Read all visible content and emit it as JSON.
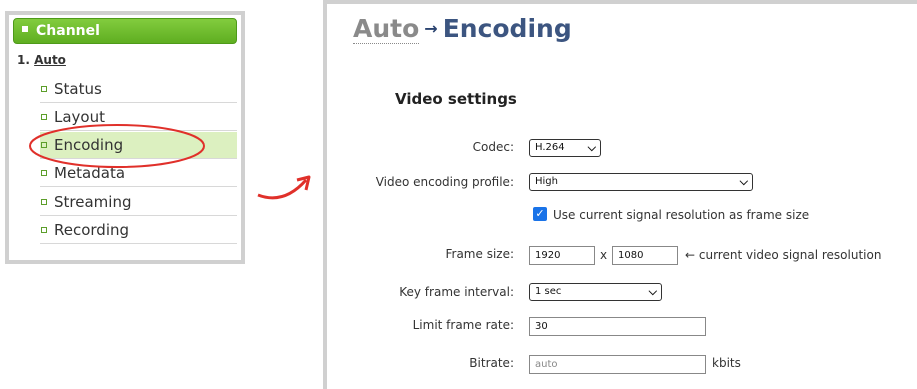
{
  "sidebar": {
    "header": "Channel",
    "group_number": "1.",
    "group_link": "Auto",
    "items": [
      {
        "label": "Status"
      },
      {
        "label": "Layout"
      },
      {
        "label": "Encoding"
      },
      {
        "label": "Metadata"
      },
      {
        "label": "Streaming"
      },
      {
        "label": "Recording"
      }
    ],
    "active_item": "Encoding",
    "accent_color": "#5fae21"
  },
  "highlight_color": "#e0302a",
  "page": {
    "breadcrumb_parent": "Auto",
    "breadcrumb_separator": "→",
    "title": "Encoding"
  },
  "video_settings": {
    "section_title": "Video settings",
    "codec_label": "Codec:",
    "codec_value": "H.264",
    "profile_label": "Video encoding profile:",
    "profile_value": "High",
    "use_signal_resolution_label": "Use current signal resolution as frame size",
    "use_signal_resolution_checked": true,
    "frame_size_label": "Frame size:",
    "frame_width": "1920",
    "frame_separator": "x",
    "frame_height": "1080",
    "frame_size_hint": "← current video signal resolution",
    "keyframe_label": "Key frame interval:",
    "keyframe_value": "1 sec",
    "frame_rate_label": "Limit frame rate:",
    "frame_rate_value": "30",
    "bitrate_label": "Bitrate:",
    "bitrate_placeholder": "auto",
    "bitrate_unit": "kbits"
  }
}
